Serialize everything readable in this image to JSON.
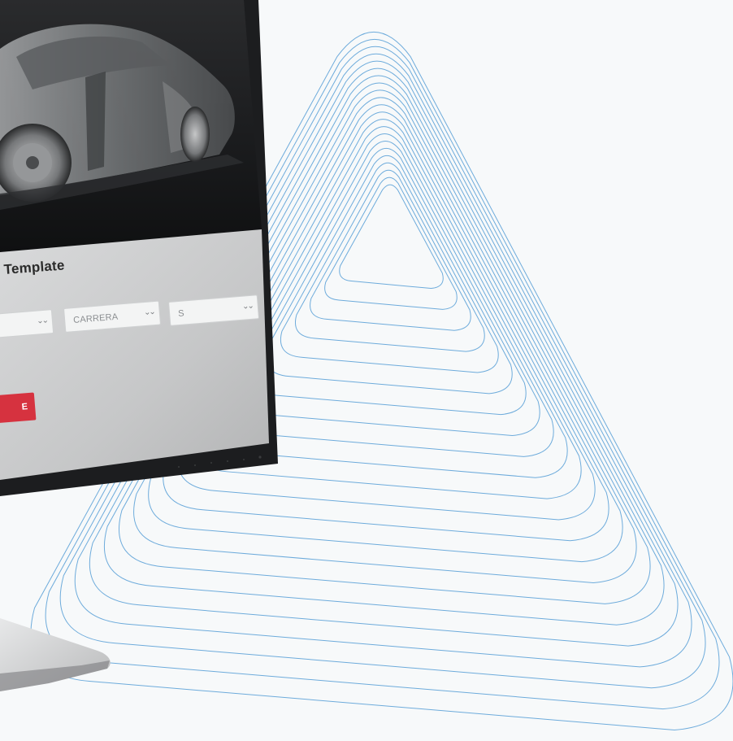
{
  "screen": {
    "section_title": "Template",
    "selects": [
      {
        "value": "",
        "chevron": "⌄⌄"
      },
      {
        "value": "CARRERA",
        "chevron": "⌄⌄"
      },
      {
        "value": "S",
        "chevron": "⌄⌄"
      }
    ],
    "cta_label": "E"
  },
  "icons": {
    "select_chevron": "chevron-down-icon"
  },
  "colors": {
    "background": "#f7f9fa",
    "contour_lines": "#5fa3d8",
    "cta": "#d6323f",
    "screen_panel": "#c9cacb",
    "bezel": "#1c1d1f"
  }
}
